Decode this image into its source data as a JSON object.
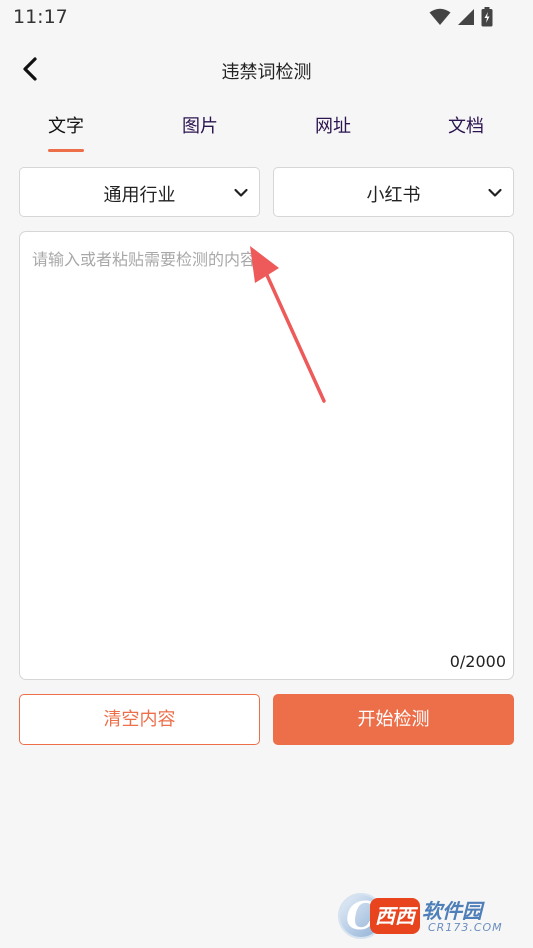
{
  "status_bar": {
    "time": "11:17",
    "icons": [
      "wifi-icon",
      "cellular-signal-icon",
      "battery-charging-icon"
    ]
  },
  "nav": {
    "title": "违禁词检测",
    "back_icon": "chevron-left-icon"
  },
  "tabs": [
    {
      "label": "文字",
      "active": true
    },
    {
      "label": "图片",
      "active": false
    },
    {
      "label": "网址",
      "active": false
    },
    {
      "label": "文档",
      "active": false
    }
  ],
  "filters": {
    "industry": {
      "selected": "通用行业"
    },
    "platform": {
      "selected": "小红书"
    }
  },
  "editor": {
    "placeholder": "请输入或者粘贴需要检测的内容",
    "value": "",
    "count": "0/2000"
  },
  "actions": {
    "clear_label": "清空内容",
    "start_label": "开始检测"
  },
  "watermark": {
    "letter": "C",
    "badge": "西西",
    "name": "软件园",
    "url": "CR173.COM"
  },
  "colors": {
    "accent": "#ec6f4a",
    "tab_text": "#2b1450",
    "background": "#f7f6f6"
  }
}
